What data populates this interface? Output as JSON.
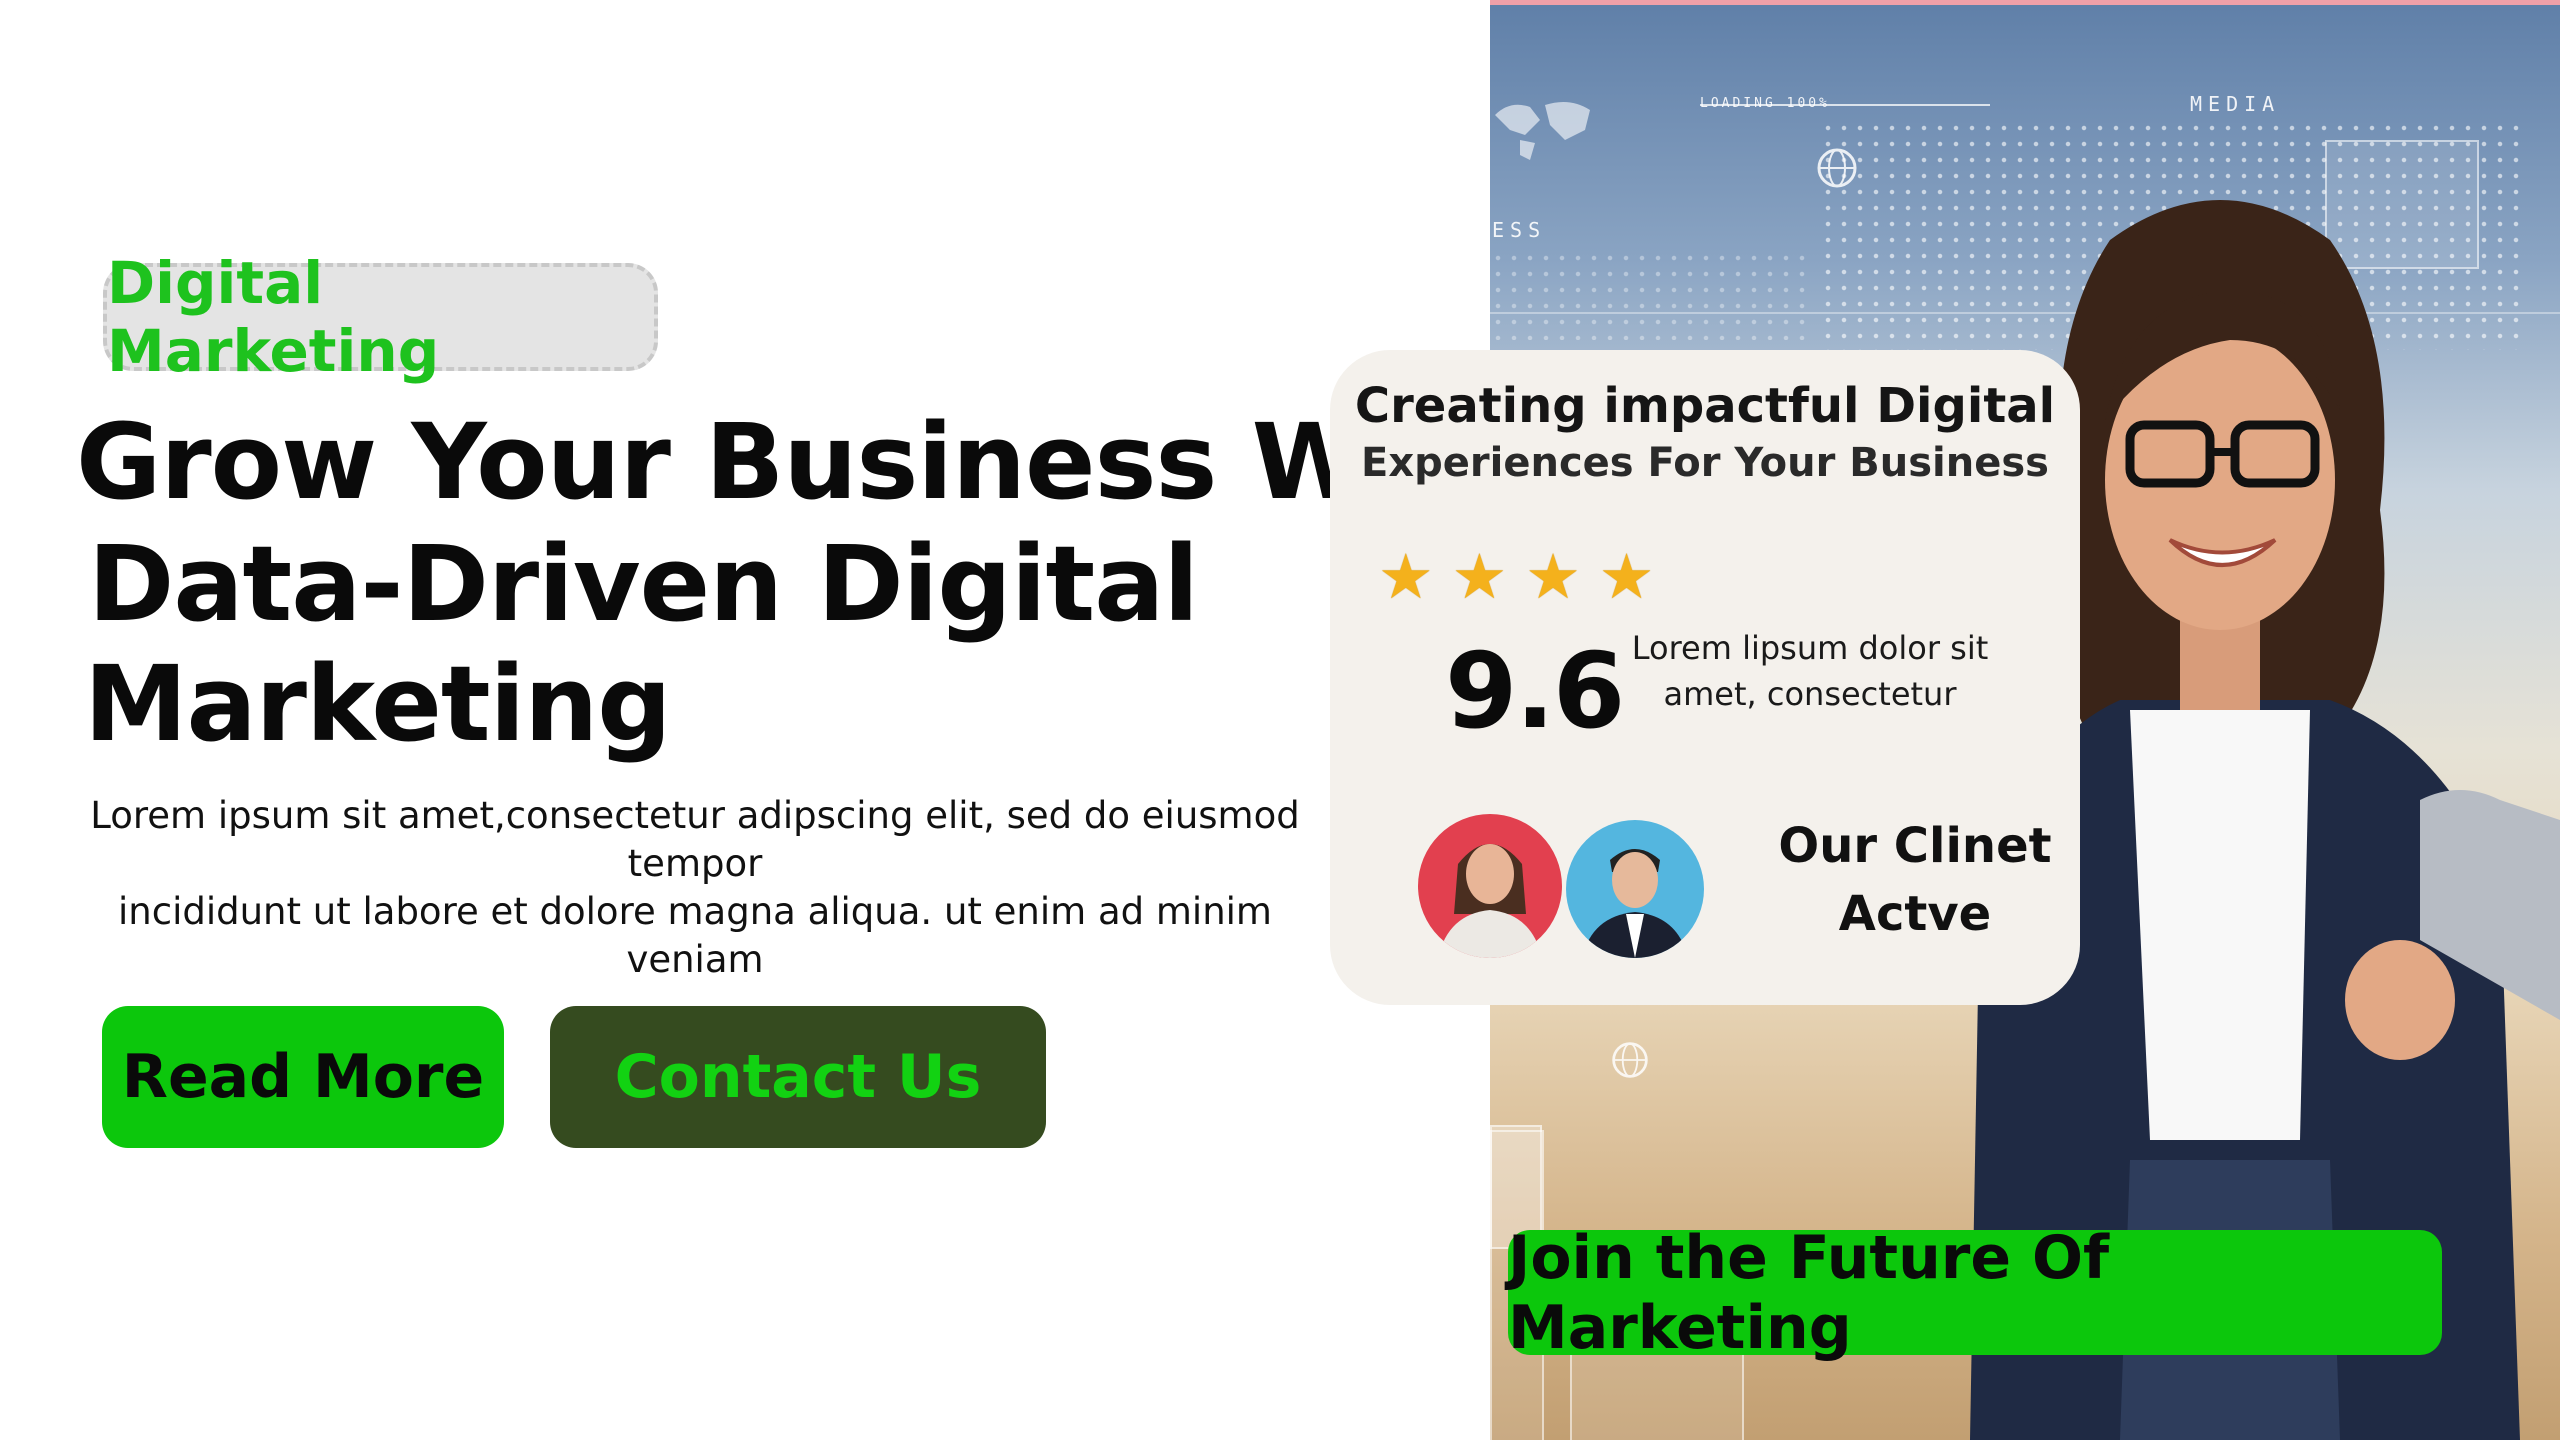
{
  "hero": {
    "tag": "Digital Marketing",
    "headline_lines": [
      "Grow Your Business With",
      "Data-Driven Digital",
      "Marketing"
    ],
    "intro_lines": [
      "Lorem ipsum sit amet,consectetur adipscing elit, sed do eiusmod tempor",
      "incididunt ut labore et dolore magna aliqua. ut enim ad minim veniam"
    ],
    "buttons": {
      "read_more": "Read More",
      "contact_us": "Contact Us"
    }
  },
  "card": {
    "title": "Creating impactful Digital",
    "subtitle": "Experiences For Your Business",
    "stars": 4,
    "score": "9.6",
    "description_lines": [
      "Lorem lipsum dolor sit",
      "amet, consectetur"
    ],
    "client_label_lines": [
      "Our Clinet",
      "Actve"
    ]
  },
  "background_text": {
    "loading": "LOADING 100%",
    "media": "MEDIA",
    "ess": "ESS"
  },
  "cta": {
    "join": "Join the Future Of Marketing"
  },
  "colors": {
    "accent_green": "#0cc70c",
    "dark_green": "#354b1f",
    "tag_green": "#1ec21e",
    "star": "#f4b11c"
  },
  "icons": [
    "star-icon",
    "globe-icon",
    "world-map-icon"
  ]
}
